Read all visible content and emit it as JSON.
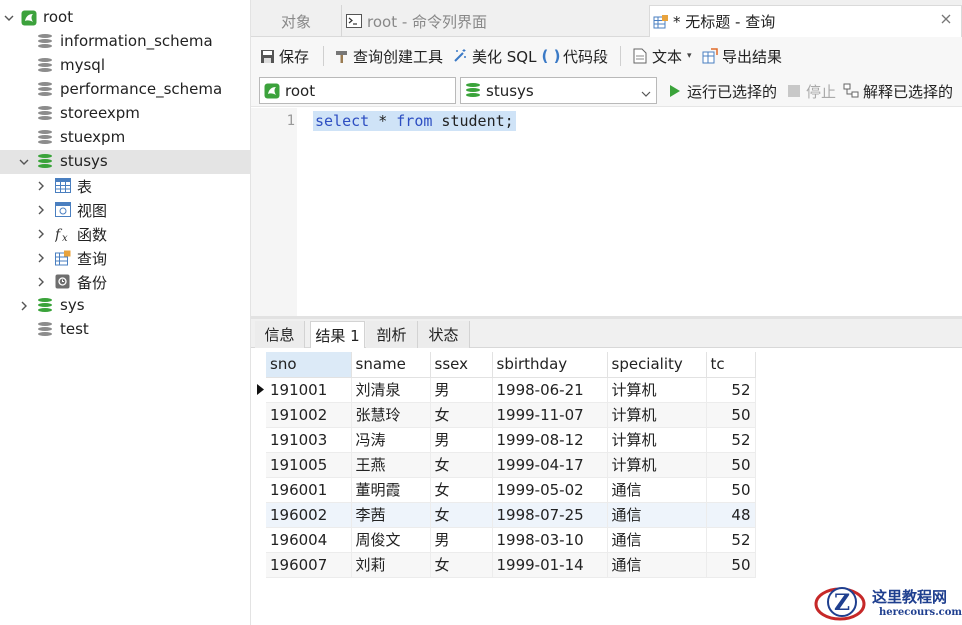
{
  "tree": {
    "connection": "root",
    "databases": [
      {
        "name": "information_schema",
        "expanded": false
      },
      {
        "name": "mysql",
        "expanded": false
      },
      {
        "name": "performance_schema",
        "expanded": false
      },
      {
        "name": "storeexpm",
        "expanded": false
      },
      {
        "name": "stuexpm",
        "expanded": false
      },
      {
        "name": "stusys",
        "expanded": true,
        "selected": true
      },
      {
        "name": "sys",
        "expanded": false
      },
      {
        "name": "test",
        "expanded": false
      }
    ],
    "children": [
      "表",
      "视图",
      "函数",
      "查询",
      "备份"
    ]
  },
  "tabs": {
    "objects": "对象",
    "console": "root - 命令列界面",
    "query": "* 无标题 - 查询"
  },
  "toolbar": {
    "save": "保存",
    "query_builder": "查询创建工具",
    "beautify": "美化 SQL",
    "snippet": "代码段",
    "text": "文本",
    "export": "导出结果"
  },
  "selbar": {
    "connection": "root",
    "database": "stusys",
    "run": "运行已选择的",
    "stop": "停止",
    "explain": "解释已选择的"
  },
  "editor": {
    "line": "1",
    "kw_select": "select",
    "star": " * ",
    "kw_from": "from",
    "rest": " student;"
  },
  "result_tabs": [
    "信息",
    "结果 1",
    "剖析",
    "状态"
  ],
  "grid": {
    "columns": [
      "sno",
      "sname",
      "ssex",
      "sbirthday",
      "speciality",
      "tc"
    ],
    "rows": [
      [
        "191001",
        "刘清泉",
        "男",
        "1998-06-21",
        "计算机",
        "52"
      ],
      [
        "191002",
        "张慧玲",
        "女",
        "1999-11-07",
        "计算机",
        "50"
      ],
      [
        "191003",
        "冯涛",
        "男",
        "1999-08-12",
        "计算机",
        "52"
      ],
      [
        "191005",
        "王燕",
        "女",
        "1999-04-17",
        "计算机",
        "50"
      ],
      [
        "196001",
        "董明霞",
        "女",
        "1999-05-02",
        "通信",
        "50"
      ],
      [
        "196002",
        "李茜",
        "女",
        "1998-07-25",
        "通信",
        "48"
      ],
      [
        "196004",
        "周俊文",
        "男",
        "1998-03-10",
        "通信",
        "52"
      ],
      [
        "196007",
        "刘莉",
        "女",
        "1999-01-14",
        "通信",
        "50"
      ]
    ]
  },
  "watermark": {
    "title": "这里教程网",
    "url": "herecours.com"
  },
  "colors": {
    "connection_green": "#3ca23c",
    "db_grey": "#8c8c8c",
    "db_active_green": "#3aa33a",
    "keyword_blue": "#2d4ec2",
    "selection_blue": "#cfe3f7"
  }
}
